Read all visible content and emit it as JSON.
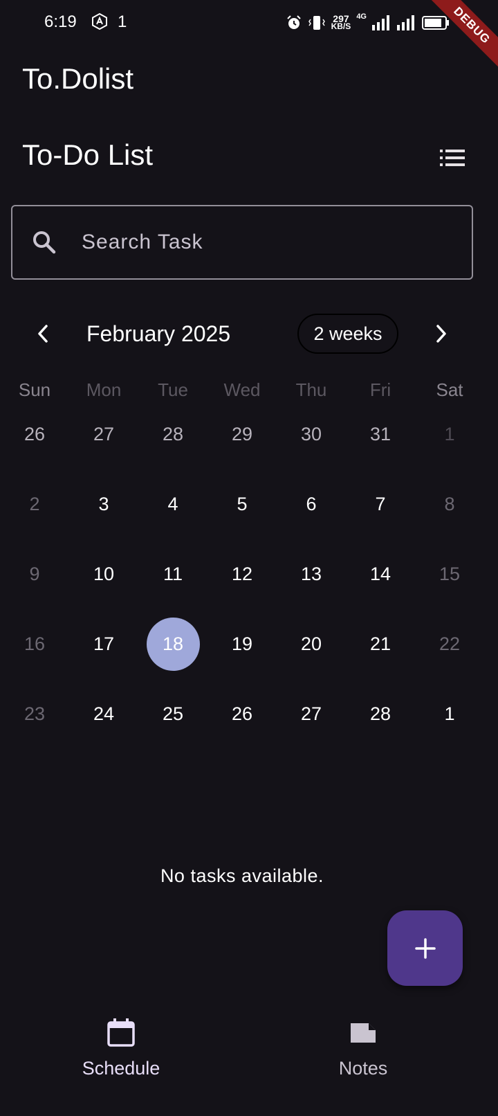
{
  "status_bar": {
    "time": "6:19",
    "notification_count": "1",
    "net_rate": "297",
    "net_unit": "KB/S",
    "network_type": "4G"
  },
  "debug_banner": "DEBUG",
  "app": {
    "title": "To.Dolist",
    "section_title": "To-Do List"
  },
  "search": {
    "placeholder": "Search Task",
    "value": ""
  },
  "calendar": {
    "month_label": "February 2025",
    "format_button": "2 weeks",
    "weekdays": [
      "Sun",
      "Mon",
      "Tue",
      "Wed",
      "Thu",
      "Fri",
      "Sat"
    ],
    "weeks": [
      [
        "26",
        "27",
        "28",
        "29",
        "30",
        "31",
        "1"
      ],
      [
        "2",
        "3",
        "4",
        "5",
        "6",
        "7",
        "8"
      ],
      [
        "9",
        "10",
        "11",
        "12",
        "13",
        "14",
        "15"
      ],
      [
        "16",
        "17",
        "18",
        "19",
        "20",
        "21",
        "22"
      ],
      [
        "23",
        "24",
        "25",
        "26",
        "27",
        "28",
        "1"
      ]
    ],
    "selected_day": "18"
  },
  "empty_state": "No tasks available.",
  "fab": {
    "icon": "plus-icon"
  },
  "bottom_nav": {
    "items": [
      {
        "label": "Schedule",
        "icon": "calendar-icon",
        "active": true
      },
      {
        "label": "Notes",
        "icon": "note-icon",
        "active": false
      }
    ]
  },
  "colors": {
    "background": "#141218",
    "selected_day": "#9fa8da",
    "fab": "#4f378b",
    "debug_ribbon": "#8e1b1b"
  }
}
